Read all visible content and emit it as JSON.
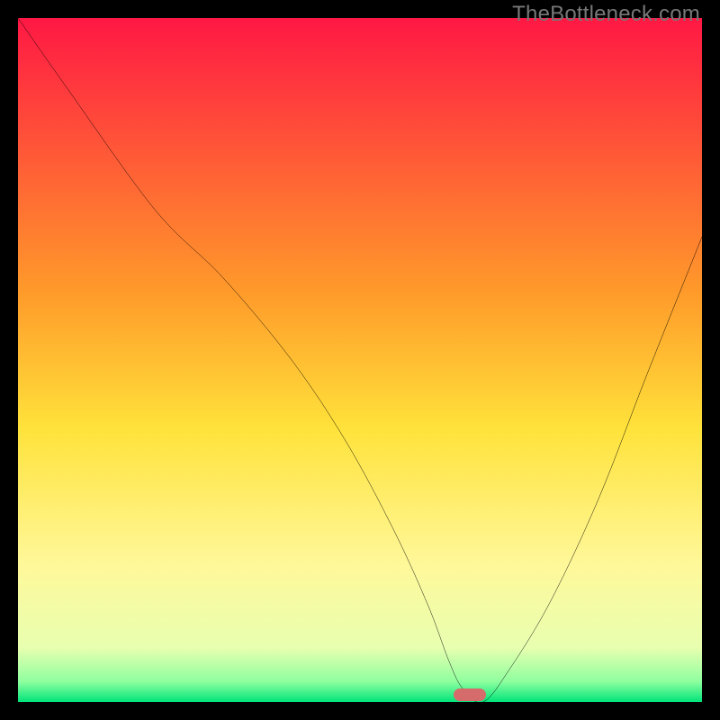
{
  "watermark": "TheBottleneck.com",
  "chart_data": {
    "type": "line",
    "title": "",
    "xlabel": "",
    "ylabel": "",
    "xlim": [
      0,
      100
    ],
    "ylim": [
      0,
      100
    ],
    "grid": false,
    "legend": false,
    "gradient_stops": [
      {
        "offset": 0,
        "color": "#ff1844"
      },
      {
        "offset": 40,
        "color": "#ff9a2a"
      },
      {
        "offset": 60,
        "color": "#ffe23a"
      },
      {
        "offset": 80,
        "color": "#fff89a"
      },
      {
        "offset": 92,
        "color": "#e8ffb0"
      },
      {
        "offset": 97,
        "color": "#8fff9f"
      },
      {
        "offset": 100,
        "color": "#00e47a"
      }
    ],
    "series": [
      {
        "name": "bottleneck-curve",
        "x": [
          0,
          7,
          20,
          30,
          40,
          48,
          55,
          60,
          63,
          65,
          68,
          72,
          78,
          85,
          92,
          100
        ],
        "y": [
          100,
          90,
          72,
          62,
          50,
          38,
          25,
          14,
          6,
          2,
          0,
          5,
          15,
          30,
          48,
          68
        ]
      }
    ],
    "marker": {
      "x": 66,
      "y": 1
    }
  }
}
